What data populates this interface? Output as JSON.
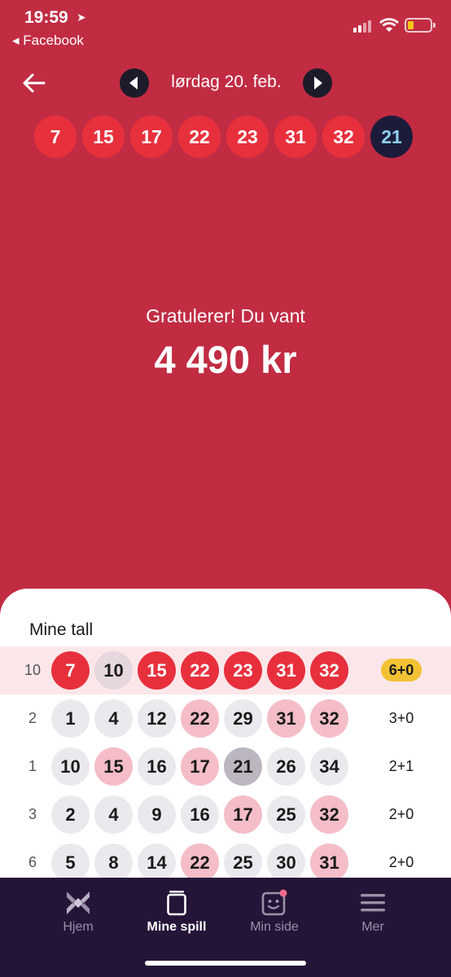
{
  "status_bar": {
    "time": "19:59",
    "back_app": "◂ Facebook"
  },
  "header": {
    "date": "lørdag 20. feb.",
    "icons": [
      "back-arrow-icon",
      "chevron-left-icon",
      "chevron-right-icon"
    ]
  },
  "draw": {
    "main_numbers": [
      "7",
      "15",
      "17",
      "22",
      "23",
      "31",
      "32"
    ],
    "extra_number": "21"
  },
  "result": {
    "message": "Gratulerer! Du vant",
    "amount": "4 490 kr"
  },
  "my_numbers": {
    "title": "Mine tall",
    "rows": [
      {
        "index": "10",
        "numbers": [
          "7",
          "10",
          "15",
          "22",
          "23",
          "31",
          "32"
        ],
        "result": "6+0"
      },
      {
        "index": "2",
        "numbers": [
          "1",
          "4",
          "12",
          "22",
          "29",
          "31",
          "32"
        ],
        "result": "3+0"
      },
      {
        "index": "1",
        "numbers": [
          "10",
          "15",
          "16",
          "17",
          "21",
          "26",
          "34"
        ],
        "result": "2+1"
      },
      {
        "index": "3",
        "numbers": [
          "2",
          "4",
          "9",
          "16",
          "17",
          "25",
          "32"
        ],
        "result": "2+0"
      },
      {
        "index": "6",
        "numbers": [
          "5",
          "8",
          "14",
          "22",
          "25",
          "30",
          "31"
        ],
        "result": "2+0"
      }
    ]
  },
  "tabbar": {
    "tabs": [
      {
        "label": "Hjem",
        "icon": "norsk-tipping-logo-icon"
      },
      {
        "label": "Mine spill",
        "icon": "tickets-icon",
        "active": true
      },
      {
        "label": "Min side",
        "icon": "profile-face-icon"
      },
      {
        "label": "Mer",
        "icon": "menu-icon"
      }
    ]
  },
  "colors": {
    "background": "#c12c43",
    "ball_red": "#e8303d",
    "extra_ball": "#1d1b3a",
    "badge_yellow": "#f3c234",
    "tabbar": "#241538"
  }
}
